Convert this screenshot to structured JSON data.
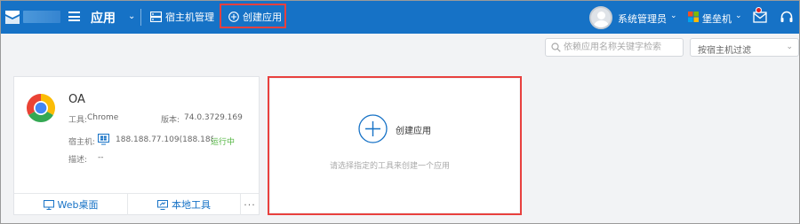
{
  "topbar": {
    "app_title": "应用",
    "nav": {
      "host_manage": "宿主机管理",
      "create_app": "创建应用"
    },
    "user_name": "系统管理员",
    "fortress": "堡垒机",
    "colors": {
      "bar": "#1672c6",
      "highlight": "#e8403e",
      "badge": "#e02020"
    },
    "icons": [
      "menu-icon",
      "host-manage-icon",
      "add-circle-icon",
      "avatar",
      "fortress-icon",
      "mail-icon",
      "headset-icon"
    ]
  },
  "filters": {
    "search_placeholder": "依赖应用名称关键字检索",
    "host_filter": "按宿主机过滤"
  },
  "app_card": {
    "name": "OA",
    "tool_label": "工具:",
    "tool_value": "Chrome",
    "version_label": "版本:",
    "version_value": "74.0.3729.169",
    "host_label": "宿主机:",
    "host_value": "188.188.77.109(188.188.",
    "status": "运行中",
    "desc_label": "描述:",
    "desc_value": "--",
    "footer": {
      "web_desktop": "Web桌面",
      "local_tool": "本地工具",
      "more": "···"
    }
  },
  "create_card": {
    "label": "创建应用",
    "hint": "请选择指定的工具来创建一个应用"
  }
}
